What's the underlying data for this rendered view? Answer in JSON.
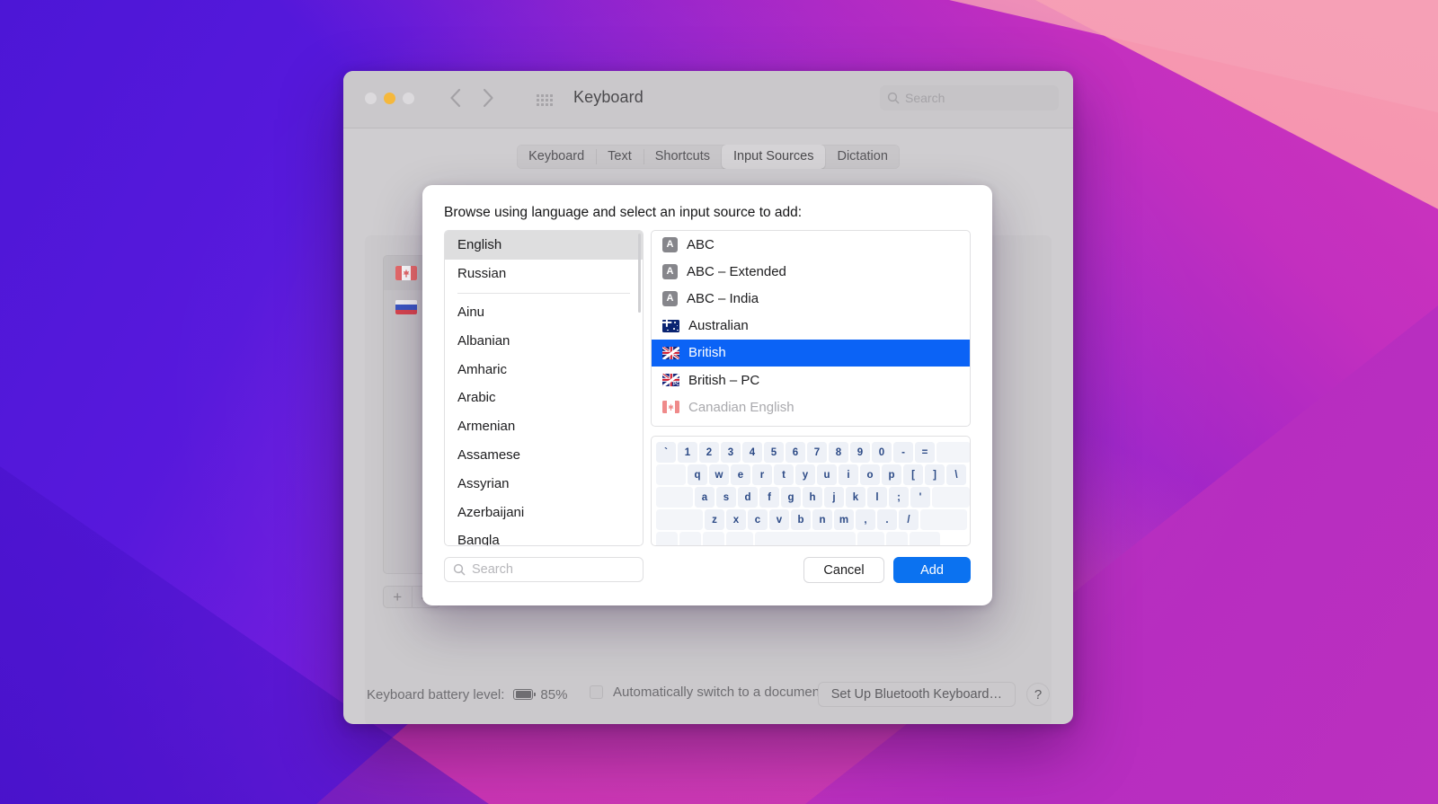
{
  "window": {
    "title": "Keyboard",
    "traffic_lights": [
      "close",
      "minimize",
      "maximize"
    ],
    "search_placeholder": "Search",
    "nav_back_icon": "chevron-left-icon",
    "nav_forward_icon": "chevron-right-icon",
    "grid_icon": "all-preferences-grid-icon"
  },
  "tabs": [
    {
      "label": "Keyboard",
      "active": false
    },
    {
      "label": "Text",
      "active": false
    },
    {
      "label": "Shortcuts",
      "active": false
    },
    {
      "label": "Input Sources",
      "active": true
    },
    {
      "label": "Dictation",
      "active": false
    }
  ],
  "background_panel": {
    "installed_sources": [
      {
        "flag": "canada-flag",
        "label": ""
      },
      {
        "flag": "russia-flag",
        "label": ""
      }
    ],
    "add_button_label": "+",
    "remove_button_label": "–",
    "auto_switch_label": "Automatically switch to a document's input source",
    "auto_switch_checked": false
  },
  "bottom_bar": {
    "battery_label": "Keyboard battery level:",
    "battery_icon": "battery-icon",
    "battery_percent": "85%",
    "bluetooth_button": "Set Up Bluetooth Keyboard…",
    "help_button": "?"
  },
  "sheet": {
    "title": "Browse using language and select an input source to add:",
    "languages": [
      {
        "label": "English",
        "selected": true
      },
      {
        "label": "Russian",
        "selected": false
      },
      {
        "separator": true
      },
      {
        "label": "Ainu",
        "selected": false
      },
      {
        "label": "Albanian",
        "selected": false
      },
      {
        "label": "Amharic",
        "selected": false
      },
      {
        "label": "Arabic",
        "selected": false
      },
      {
        "label": "Armenian",
        "selected": false
      },
      {
        "label": "Assamese",
        "selected": false
      },
      {
        "label": "Assyrian",
        "selected": false
      },
      {
        "label": "Azerbaijani",
        "selected": false
      },
      {
        "label": "Bangla",
        "selected": false
      }
    ],
    "input_sources": [
      {
        "label": "ABC",
        "icon": "abc-icon",
        "selected": false,
        "disabled": false
      },
      {
        "label": "ABC – Extended",
        "icon": "abc-icon",
        "selected": false,
        "disabled": false
      },
      {
        "label": "ABC – India",
        "icon": "abc-icon",
        "selected": false,
        "disabled": false
      },
      {
        "label": "Australian",
        "icon": "australia-flag",
        "selected": false,
        "disabled": false
      },
      {
        "label": "British",
        "icon": "uk-flag",
        "selected": true,
        "disabled": false
      },
      {
        "label": "British – PC",
        "icon": "uk-flag-pc",
        "selected": false,
        "disabled": false
      },
      {
        "label": "Canadian English",
        "icon": "canada-flag",
        "selected": false,
        "disabled": true
      }
    ],
    "abc_icon_letter": "A",
    "pc_badge_label": "PC",
    "keyboard_preview": {
      "rows": [
        [
          "`",
          "1",
          "2",
          "3",
          "4",
          "5",
          "6",
          "7",
          "8",
          "9",
          "0",
          "-",
          "="
        ],
        [
          "q",
          "w",
          "e",
          "r",
          "t",
          "y",
          "u",
          "i",
          "o",
          "p",
          "[",
          "]",
          "\\"
        ],
        [
          "a",
          "s",
          "d",
          "f",
          "g",
          "h",
          "j",
          "k",
          "l",
          ";",
          "'"
        ],
        [
          "z",
          "x",
          "c",
          "v",
          "b",
          "n",
          "m",
          ",",
          ".",
          "/"
        ]
      ]
    },
    "search_placeholder": "Search",
    "cancel_label": "Cancel",
    "add_label": "Add"
  },
  "colors": {
    "accent_blue": "#0b63f6",
    "add_button_blue": "#0b72f0",
    "selected_language_gray": "#dededf",
    "window_chrome": "#cfcdd0"
  }
}
